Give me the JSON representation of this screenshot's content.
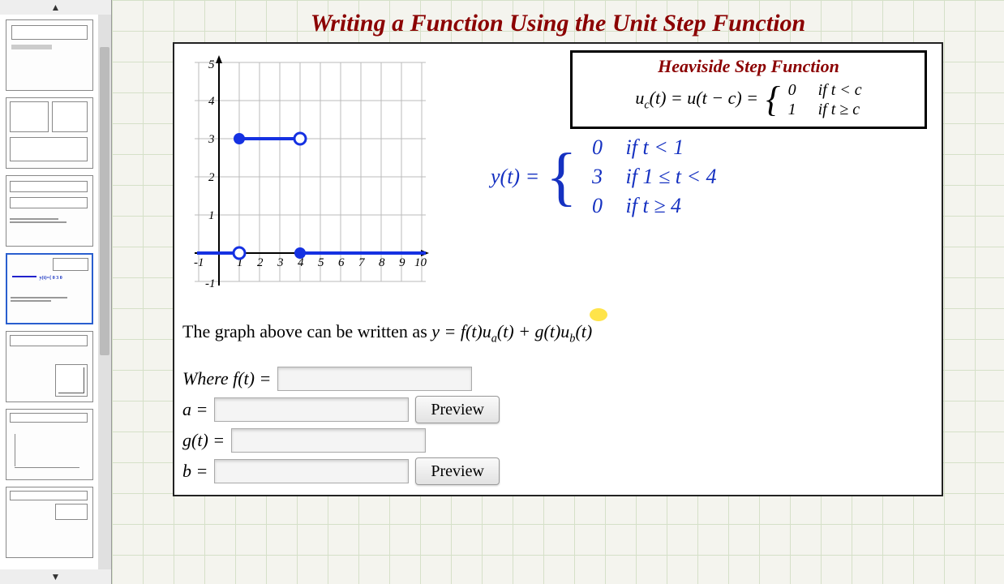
{
  "title": "Writing a Function Using the Unit Step Function",
  "heaviside": {
    "title": "Heaviside Step Function",
    "lhs": "u_c(t) = u(t − c) =",
    "case1_val": "0",
    "case1_cond": "if t < c",
    "case2_val": "1",
    "case2_cond": "if t ≥ c"
  },
  "handwritten": {
    "lhs": "y(t) =",
    "case1_val": "0",
    "case1_cond": "if t < 1",
    "case2_val": "3",
    "case2_cond": "if 1 ≤ t < 4",
    "case3_val": "0",
    "case3_cond": "if t ≥ 4"
  },
  "statement": {
    "prefix": "The graph above can be written as ",
    "formula_plain": "y = f(t)u_a(t) + g(t)u_b(t)"
  },
  "form": {
    "where": "Where ",
    "ft_label": "f(t) =",
    "ft_value": "",
    "a_label": "a =",
    "a_value": "",
    "g_label": "g(t) =",
    "g_value": "",
    "b_label": "b =",
    "b_value": "",
    "preview_label": "Preview"
  },
  "chart_data": {
    "type": "line",
    "title": "",
    "xlabel": "",
    "ylabel": "",
    "xlim": [
      -1,
      10
    ],
    "ylim": [
      -1,
      5
    ],
    "xticks": [
      -1,
      0,
      1,
      2,
      3,
      4,
      5,
      6,
      7,
      8,
      9,
      10
    ],
    "yticks": [
      -1,
      0,
      1,
      2,
      3,
      4,
      5
    ],
    "segments": [
      {
        "from": {
          "t": -1,
          "y": 0
        },
        "to": {
          "t": 1,
          "y": 0
        },
        "left_open": false,
        "right_open": true
      },
      {
        "from": {
          "t": 1,
          "y": 3
        },
        "to": {
          "t": 4,
          "y": 3
        },
        "left_closed": true,
        "right_open": true
      },
      {
        "from": {
          "t": 4,
          "y": 0
        },
        "to": {
          "t": 10,
          "y": 0
        },
        "left_closed": true,
        "right_open": false
      }
    ]
  },
  "sidebar": {
    "scroll_up": "▲",
    "scroll_down": "▼"
  }
}
